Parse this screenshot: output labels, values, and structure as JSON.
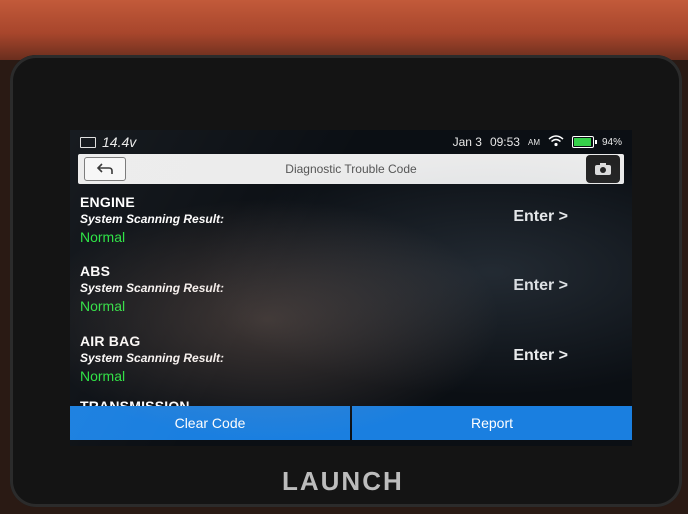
{
  "status_bar": {
    "voltage": "14.4v",
    "date": "Jan 3",
    "time": "09:53",
    "ampm": "AM",
    "battery_percent": "94%",
    "battery_level": 0.94
  },
  "title_bar": {
    "title": "Diagnostic Trouble Code"
  },
  "systems": [
    {
      "name": "ENGINE",
      "label": "System Scanning Result:",
      "result": "Normal",
      "action": "Enter >"
    },
    {
      "name": "ABS",
      "label": "System Scanning Result:",
      "result": "Normal",
      "action": "Enter >"
    },
    {
      "name": "AIR BAG",
      "label": "System Scanning Result:",
      "result": "Normal",
      "action": "Enter >"
    },
    {
      "name": "TRANSMISSION"
    }
  ],
  "bottom": {
    "clear_code": "Clear Code",
    "report": "Report"
  },
  "brand": "LAUNCH",
  "icons": [
    "battery-small-icon",
    "wifi-icon",
    "battery-icon",
    "back-arrow-icon",
    "camera-icon"
  ],
  "colors": {
    "accent_blue": "#1a7fe0",
    "normal_green": "#27e340",
    "title_bar_bg": "#ececec"
  }
}
